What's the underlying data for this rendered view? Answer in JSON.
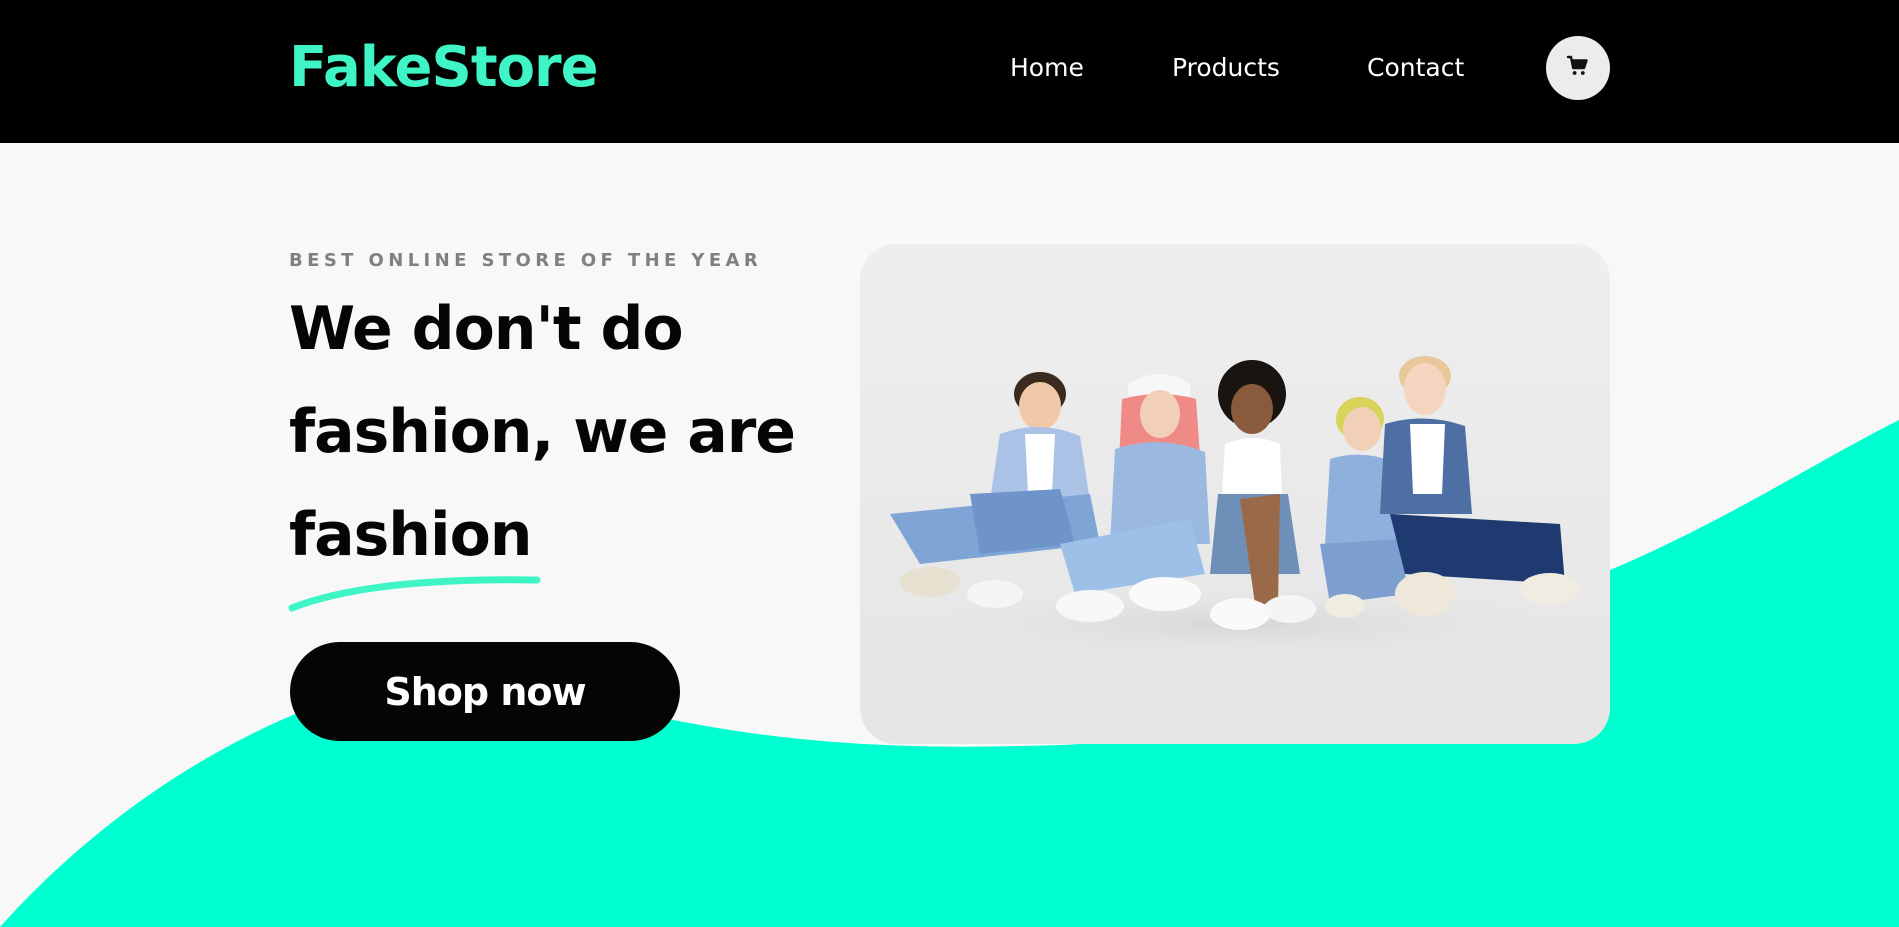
{
  "header": {
    "logo": "FakeStore",
    "nav": {
      "home": "Home",
      "products": "Products",
      "contact": "Contact"
    },
    "cart_icon": "shopping-cart-icon"
  },
  "hero": {
    "eyebrow": "BEST ONLINE STORE OF THE YEAR",
    "headline_lines": [
      "We don't do",
      "fashion, we are",
      "fashion"
    ],
    "cta_label": "Shop now",
    "image_subject": "group-of-five-young-people-sitting-on-floor"
  },
  "colors": {
    "accent": "#3ff5c6",
    "wave": "#00ffd0",
    "header_bg": "#000000",
    "page_bg": "#f8f8f8",
    "button_bg": "#050505",
    "eyebrow_text": "#808080"
  }
}
